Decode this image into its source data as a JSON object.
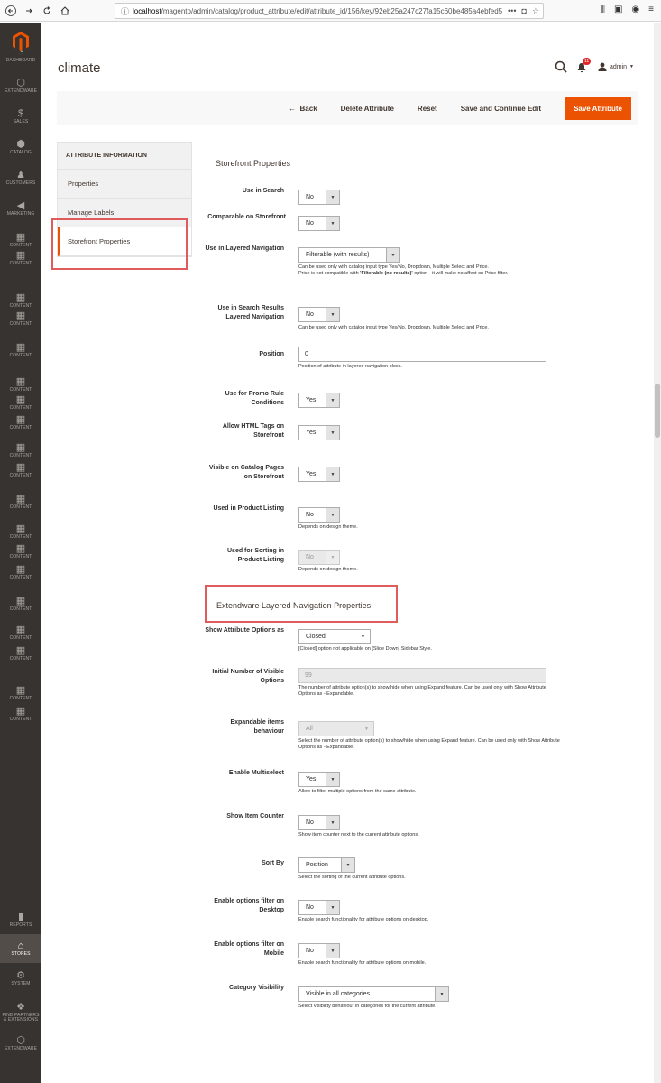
{
  "browser": {
    "url_prefix": "localhost",
    "url_rest": "/magento/admin/catalog/product_attribute/edit/attribute_id/156/key/92eb25a247c27fa15c60be485a4ebfed5...",
    "more": "•••"
  },
  "sidebar": {
    "items": [
      {
        "label": "DASHBOARD",
        "icon": "dashboard-icon"
      },
      {
        "label": "EXTENDWARE",
        "icon": "extendware-icon"
      },
      {
        "label": "SALES",
        "icon": "dollar-icon"
      },
      {
        "label": "CATALOG",
        "icon": "cube-icon"
      },
      {
        "label": "CUSTOMERS",
        "icon": "person-icon"
      },
      {
        "label": "MARKETING",
        "icon": "megaphone-icon"
      },
      {
        "label": "CONTENT",
        "icon": "layout-icon"
      },
      {
        "label": "CONTENT",
        "icon": "layout-icon"
      },
      {
        "label": "CONTENT",
        "icon": "layout-icon"
      },
      {
        "label": "CONTENT",
        "icon": "layout-icon"
      },
      {
        "label": "CONTENT",
        "icon": "layout-icon"
      },
      {
        "label": "CONTENT",
        "icon": "layout-icon"
      },
      {
        "label": "CONTENT",
        "icon": "layout-icon"
      },
      {
        "label": "CONTENT",
        "icon": "layout-icon"
      },
      {
        "label": "CONTENT",
        "icon": "layout-icon"
      },
      {
        "label": "CONTENT",
        "icon": "layout-icon"
      },
      {
        "label": "CONTENT",
        "icon": "layout-icon"
      },
      {
        "label": "CONTENT",
        "icon": "layout-icon"
      },
      {
        "label": "CONTENT",
        "icon": "layout-icon"
      },
      {
        "label": "CONTENT",
        "icon": "layout-icon"
      },
      {
        "label": "CONTENT",
        "icon": "layout-icon"
      },
      {
        "label": "CONTENT",
        "icon": "layout-icon"
      },
      {
        "label": "CONTENT",
        "icon": "layout-icon"
      },
      {
        "label": "CONTENT",
        "icon": "layout-icon"
      },
      {
        "label": "CONTENT",
        "icon": "layout-icon"
      },
      {
        "label": "REPORTS",
        "icon": "bar-chart-icon"
      },
      {
        "label": "STORES",
        "icon": "store-icon"
      },
      {
        "label": "SYSTEM",
        "icon": "gear-icon"
      },
      {
        "label": "FIND PARTNERS & EXTENSIONS",
        "icon": "partners-icon"
      },
      {
        "label": "EXTENDWARE",
        "icon": "extendware-icon"
      }
    ]
  },
  "header": {
    "title": "climate",
    "notifications": "11",
    "user": "admin"
  },
  "actions": {
    "back": "Back",
    "delete": "Delete Attribute",
    "reset": "Reset",
    "save_continue": "Save and Continue Edit",
    "save": "Save Attribute"
  },
  "tabs": {
    "heading": "ATTRIBUTE INFORMATION",
    "items": [
      "Properties",
      "Manage Labels",
      "Storefront Properties"
    ]
  },
  "storefront": {
    "title": "Storefront Properties",
    "use_in_search": {
      "label": "Use in Search",
      "value": "No"
    },
    "comparable": {
      "label": "Comparable on Storefront",
      "value": "No"
    },
    "layered_nav": {
      "label": "Use in Layered Navigation",
      "value": "Filterable (with results)",
      "note1": "Can be used only with catalog input type Yes/No, Dropdown, Multiple Select and Price.",
      "note2a": "Price is not compatible with ",
      "note2b": "'Filterable (no results)'",
      "note2c": " option - it will make no affect on Price filter."
    },
    "search_results_layered": {
      "label": "Use in Search Results Layered Navigation",
      "value": "No",
      "note": "Can be used only with catalog input type Yes/No, Dropdown, Multiple Select and Price."
    },
    "position": {
      "label": "Position",
      "value": "0",
      "note": "Position of attribute in layered navigation block."
    },
    "promo": {
      "label": "Use for Promo Rule Conditions",
      "value": "Yes"
    },
    "html_tags": {
      "label": "Allow HTML Tags on Storefront",
      "value": "Yes"
    },
    "visible_catalog": {
      "label": "Visible on Catalog Pages on Storefront",
      "value": "Yes"
    },
    "product_listing": {
      "label": "Used in Product Listing",
      "value": "No",
      "note": "Depends on design theme."
    },
    "sorting": {
      "label": "Used for Sorting in Product Listing",
      "value": "No",
      "note": "Depends on design theme."
    }
  },
  "extendware": {
    "title": "Extendware Layered Navigation Properties",
    "show_options": {
      "label": "Show Attribute Options as",
      "value": "Closed",
      "note": "[Closed] option not applicable on [Slide Down] Sidebar Style."
    },
    "initial_visible": {
      "label": "Initial Number of Visible Options",
      "value": "99",
      "note": "The number of attribute option(s) to show/hide when using Expand feature. Can be used only with Show Attribute Options as - Expandable."
    },
    "expandable": {
      "label": "Expandable items behaviour",
      "value": "All",
      "note": "Select the number of attribute option(s) to show/hide when using Expand feature. Can be used only with Show Attribute Options as - Expandable."
    },
    "multiselect": {
      "label": "Enable Multiselect",
      "value": "Yes",
      "note": "Allow to filter multiple options from the same attribute."
    },
    "item_counter": {
      "label": "Show Item Counter",
      "value": "No",
      "note": "Show item counter next to the current attribute options."
    },
    "sort_by": {
      "label": "Sort By",
      "value": "Position",
      "note": "Select the sorting of the current attribute options."
    },
    "filter_desktop": {
      "label": "Enable options filter on Desktop",
      "value": "No",
      "note": "Enable search functionality for attribute options on desktop."
    },
    "filter_mobile": {
      "label": "Enable options filter on Mobile",
      "value": "No",
      "note": "Enable search functionality for attribute options on mobile."
    },
    "category_visibility": {
      "label": "Category Visibility",
      "value": "Visible in all categories",
      "note": "Select visibility behaviour in categories for the current attribute."
    }
  },
  "colors": {
    "accent": "#eb5202",
    "sidebar": "#373330",
    "highlight": "#e05b5b"
  }
}
